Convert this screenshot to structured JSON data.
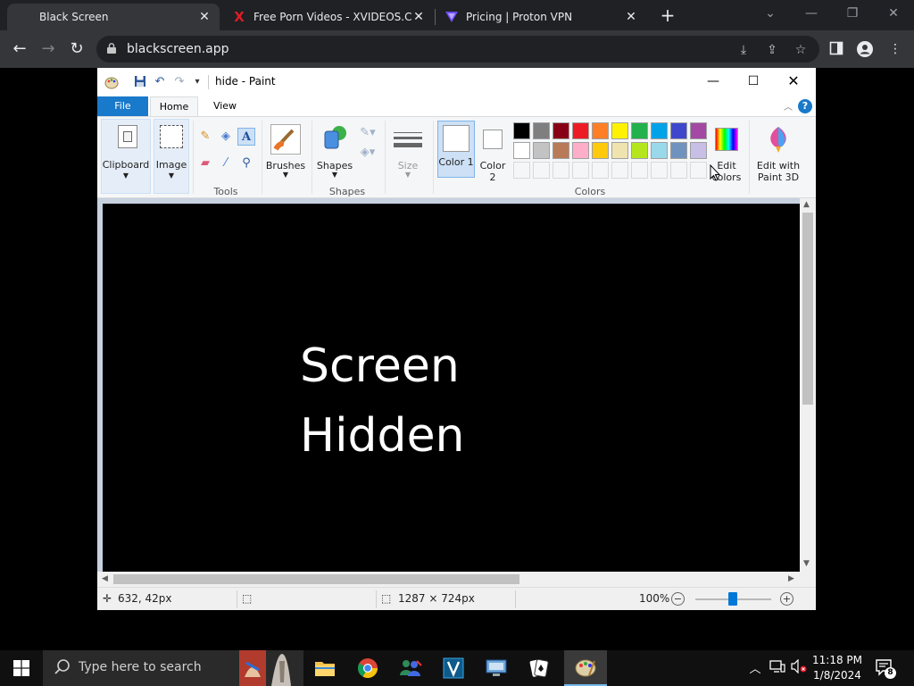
{
  "browser": {
    "tabs": [
      {
        "title": "Black Screen",
        "active": true
      },
      {
        "title": "Free Porn Videos - XVIDEOS.COM",
        "favicon": "X",
        "favicon_color": "#e01b24"
      },
      {
        "title": "Pricing | Proton VPN",
        "favicon_color": "#6d4aff"
      }
    ],
    "new_tab": "+",
    "url": "blackscreen.app"
  },
  "paint": {
    "title": "hide - Paint",
    "ribbon_tabs": {
      "file": "File",
      "home": "Home",
      "view": "View"
    },
    "help": "?",
    "groups": {
      "clipboard": "Clipboard",
      "image": "Image",
      "tools": "Tools",
      "brushes": "Brushes",
      "shapes_btn": "Shapes",
      "shapes": "Shapes",
      "size": "Size",
      "color1": "Color 1",
      "color2": "Color 2",
      "colors": "Colors",
      "edit_colors": "Edit colors",
      "edit_paint3d": "Edit with Paint 3D"
    },
    "palette_row1": [
      "#000000",
      "#7f7f7f",
      "#880015",
      "#ed1c24",
      "#ff7f27",
      "#fff200",
      "#22b14c",
      "#00a2e8",
      "#3f48cc",
      "#a349a4"
    ],
    "palette_row2": [
      "#ffffff",
      "#c3c3c3",
      "#b97a57",
      "#ffaec9",
      "#ffc90e",
      "#efe4b0",
      "#b5e61d",
      "#99d9ea",
      "#7092be",
      "#c8bfe7"
    ],
    "canvas": {
      "line1": "Screen",
      "line2": "Hidden",
      "background": "#000000",
      "text_color": "#ffffff"
    },
    "status": {
      "cursor": "632, 42px",
      "size": "1287 × 724px",
      "zoom": "100%"
    }
  },
  "taskbar": {
    "search_placeholder": "Type here to search",
    "time": "11:18 PM",
    "date": "1/8/2024",
    "notifications": "8"
  }
}
